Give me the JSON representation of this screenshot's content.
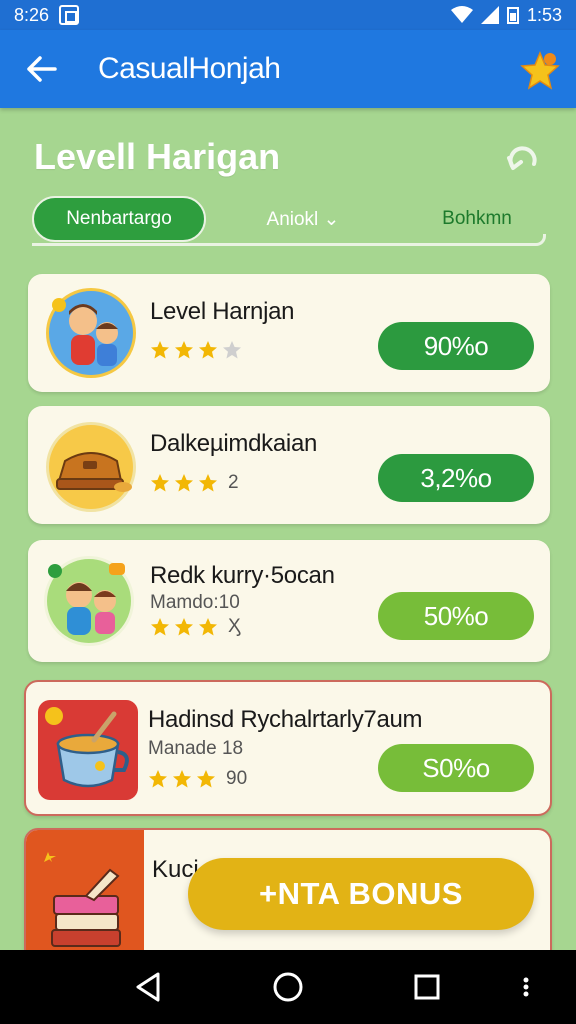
{
  "status_bar": {
    "time": "8:26",
    "battery": "1:53"
  },
  "app_bar": {
    "title": "CasualHonjah"
  },
  "page": {
    "title": "Levell Harigan"
  },
  "tabs": [
    {
      "label": "Nenbartargo"
    },
    {
      "label": "Aniokl ⌄"
    },
    {
      "label": "Bohkmn"
    }
  ],
  "cards": [
    {
      "title": "Level Harnjan",
      "stars_filled": 3,
      "stars_total": 4,
      "rating_text": "",
      "subtitle": "",
      "percent": "90%o"
    },
    {
      "title": "Dalkeµimdkaian",
      "stars_filled": 3,
      "stars_total": 3,
      "rating_text": "2",
      "subtitle": "",
      "percent": "3,2%o"
    },
    {
      "title": "Redk kurry·5ocan",
      "stars_filled": 3,
      "stars_total": 3,
      "rating_text": "Ӽ",
      "subtitle": "Mamdo:10",
      "percent": "50%o"
    },
    {
      "title": "Hadinsd Rychalrtarly7aum",
      "stars_filled": 3,
      "stars_total": 3,
      "rating_text": "90",
      "subtitle": "Manade 18",
      "percent": "S0%o"
    },
    {
      "title": "Kuci",
      "subtitle": "",
      "percent": ""
    }
  ],
  "bonus_button": {
    "label": "+NTA BONUS"
  },
  "colors": {
    "status_bar": "#1f6fd2",
    "app_bar": "#1f78e0",
    "background": "#a6d690",
    "tab_active": "#2e9e3e",
    "percent_dark": "#2c9a3f",
    "percent_light": "#77bd39",
    "bonus": "#e2b315",
    "star": "#f2b705"
  }
}
